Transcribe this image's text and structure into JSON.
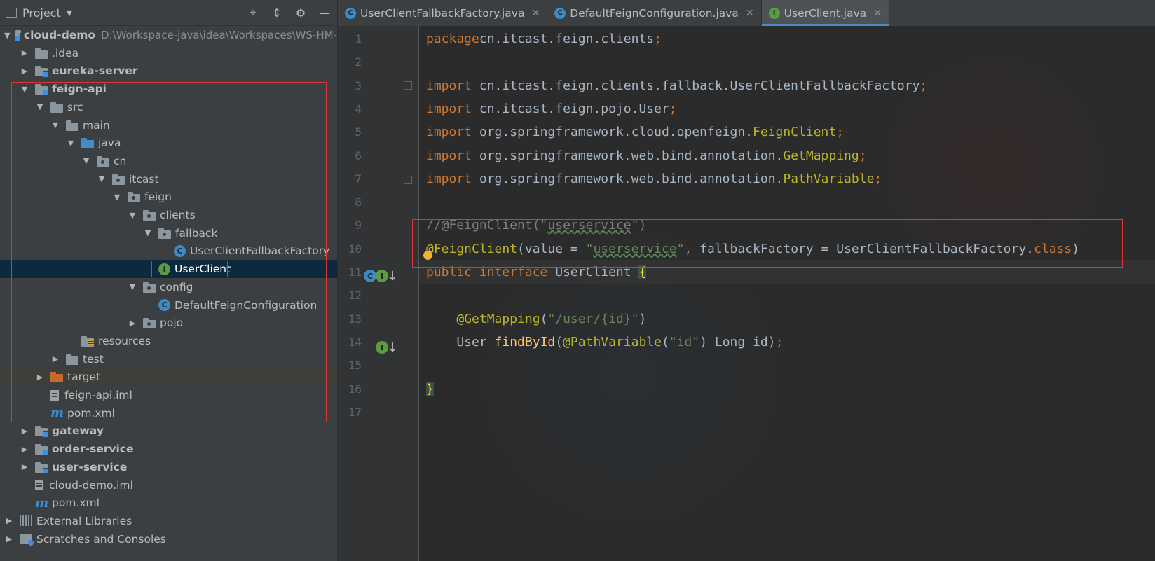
{
  "project_panel": {
    "title": "Project",
    "tree": [
      {
        "label": "cloud-demo",
        "path": "D:\\Workspace-java\\idea\\Workspaces\\WS-HM-",
        "bold": true,
        "depth": 0,
        "expanded": true,
        "icon": "module-folder-icon"
      },
      {
        "label": ".idea",
        "depth": 1,
        "expanded": false,
        "icon": "folder-icon"
      },
      {
        "label": "eureka-server",
        "bold": true,
        "depth": 1,
        "expanded": false,
        "icon": "module-folder-icon"
      },
      {
        "label": "feign-api",
        "bold": true,
        "depth": 1,
        "expanded": true,
        "icon": "module-folder-icon"
      },
      {
        "label": "src",
        "depth": 2,
        "expanded": true,
        "icon": "folder-icon"
      },
      {
        "label": "main",
        "depth": 3,
        "expanded": true,
        "icon": "folder-icon"
      },
      {
        "label": "java",
        "depth": 4,
        "expanded": true,
        "icon": "source-folder-icon"
      },
      {
        "label": "cn",
        "depth": 5,
        "expanded": true,
        "icon": "package-icon"
      },
      {
        "label": "itcast",
        "depth": 6,
        "expanded": true,
        "icon": "package-icon"
      },
      {
        "label": "feign",
        "depth": 7,
        "expanded": true,
        "icon": "package-icon"
      },
      {
        "label": "clients",
        "depth": 8,
        "expanded": true,
        "icon": "package-icon"
      },
      {
        "label": "fallback",
        "depth": 9,
        "expanded": true,
        "icon": "package-icon"
      },
      {
        "label": "UserClientFallbackFactory",
        "depth": 10,
        "icon": "class-icon"
      },
      {
        "label": "UserClient",
        "depth": 9,
        "icon": "interface-icon",
        "selected": true
      },
      {
        "label": "config",
        "depth": 8,
        "expanded": true,
        "icon": "package-icon"
      },
      {
        "label": "DefaultFeignConfiguration",
        "depth": 9,
        "icon": "class-icon"
      },
      {
        "label": "pojo",
        "depth": 8,
        "expanded": false,
        "icon": "package-icon"
      },
      {
        "label": "resources",
        "depth": 4,
        "icon": "resources-folder-icon"
      },
      {
        "label": "test",
        "depth": 3,
        "expanded": false,
        "icon": "folder-icon"
      },
      {
        "label": "target",
        "depth": 2,
        "expanded": false,
        "icon": "excluded-folder-icon"
      },
      {
        "label": "feign-api.iml",
        "depth": 2,
        "icon": "iml-file-icon"
      },
      {
        "label": "pom.xml",
        "depth": 2,
        "icon": "maven-icon"
      },
      {
        "label": "gateway",
        "bold": true,
        "depth": 1,
        "expanded": false,
        "icon": "module-folder-icon"
      },
      {
        "label": "order-service",
        "bold": true,
        "depth": 1,
        "expanded": false,
        "icon": "module-folder-icon"
      },
      {
        "label": "user-service",
        "bold": true,
        "depth": 1,
        "expanded": false,
        "icon": "module-folder-icon"
      },
      {
        "label": "cloud-demo.iml",
        "depth": 1,
        "icon": "iml-file-icon"
      },
      {
        "label": "pom.xml",
        "depth": 1,
        "icon": "maven-icon"
      },
      {
        "label": "External Libraries",
        "depth": 0,
        "expanded": false,
        "icon": "libraries-icon"
      },
      {
        "label": "Scratches and Consoles",
        "depth": 0,
        "expanded": false,
        "icon": "scratches-icon"
      }
    ]
  },
  "tabs": [
    {
      "label": "UserClientFallbackFactory.java",
      "icon": "class-icon",
      "active": false
    },
    {
      "label": "DefaultFeignConfiguration.java",
      "icon": "class-icon",
      "active": false
    },
    {
      "label": "UserClient.java",
      "icon": "interface-icon",
      "active": true
    }
  ],
  "editor": {
    "current_line": 11,
    "lines": [
      {
        "n": "1",
        "tokens": [
          [
            "kw",
            "package"
          ],
          [
            "",
            "cn.itcast.feign.clients"
          ],
          [
            "kw",
            ";"
          ]
        ]
      },
      {
        "n": "2",
        "tokens": []
      },
      {
        "n": "3",
        "tokens": [
          [
            "kw",
            "import"
          ],
          [
            "",
            " cn.itcast.feign.clients.fallback.UserClientFallbackFactory"
          ],
          [
            "kw",
            ";"
          ]
        ]
      },
      {
        "n": "4",
        "tokens": [
          [
            "kw",
            "import"
          ],
          [
            "",
            " cn.itcast.feign.pojo.User"
          ],
          [
            "kw",
            ";"
          ]
        ]
      },
      {
        "n": "5",
        "tokens": [
          [
            "kw",
            "import"
          ],
          [
            "",
            " org.springframework.cloud.openfeign."
          ],
          [
            "ann",
            "FeignClient"
          ],
          [
            "kw",
            ";"
          ]
        ]
      },
      {
        "n": "6",
        "tokens": [
          [
            "kw",
            "import"
          ],
          [
            "",
            " org.springframework.web.bind.annotation."
          ],
          [
            "ann",
            "GetMapping"
          ],
          [
            "kw",
            ";"
          ]
        ]
      },
      {
        "n": "7",
        "tokens": [
          [
            "kw",
            "import"
          ],
          [
            "",
            " org.springframework.web.bind.annotation."
          ],
          [
            "ann",
            "PathVariable"
          ],
          [
            "kw",
            ";"
          ]
        ]
      },
      {
        "n": "8",
        "tokens": []
      },
      {
        "n": "9",
        "tokens": [
          [
            "cmt",
            "//@FeignClient(\""
          ],
          [
            "cmt und",
            "userservice"
          ],
          [
            "cmt",
            "\")"
          ]
        ]
      },
      {
        "n": "10",
        "tokens": [
          [
            "ann",
            "@FeignClient"
          ],
          [
            "",
            "(value = "
          ],
          [
            "str",
            "\""
          ],
          [
            "str und",
            "userservice"
          ],
          [
            "str",
            "\""
          ],
          [
            "kw",
            ","
          ],
          [
            "",
            " fallbackFactory = UserClientFallbackFactory."
          ],
          [
            "kw",
            "class"
          ],
          [
            "",
            ")"
          ]
        ]
      },
      {
        "n": "11",
        "tokens": [
          [
            "kw",
            "public interface"
          ],
          [
            "",
            " UserClient "
          ],
          [
            "brace-hl",
            "{"
          ]
        ]
      },
      {
        "n": "12",
        "tokens": []
      },
      {
        "n": "13",
        "tokens": [
          [
            "",
            "    "
          ],
          [
            "ann",
            "@GetMapping"
          ],
          [
            "",
            "("
          ],
          [
            "str",
            "\"/user/{id}\""
          ],
          [
            "",
            ")"
          ]
        ]
      },
      {
        "n": "14",
        "tokens": [
          [
            "",
            "    User "
          ],
          [
            "fn",
            "findById"
          ],
          [
            "",
            "("
          ],
          [
            "ann",
            "@PathVariable"
          ],
          [
            "",
            "("
          ],
          [
            "str",
            "\"id\""
          ],
          [
            "",
            ") Long id)"
          ],
          [
            "kw",
            ";"
          ]
        ]
      },
      {
        "n": "15",
        "tokens": []
      },
      {
        "n": "16",
        "tokens": [
          [
            "brace-hl",
            "}"
          ]
        ]
      },
      {
        "n": "17",
        "tokens": []
      }
    ]
  }
}
